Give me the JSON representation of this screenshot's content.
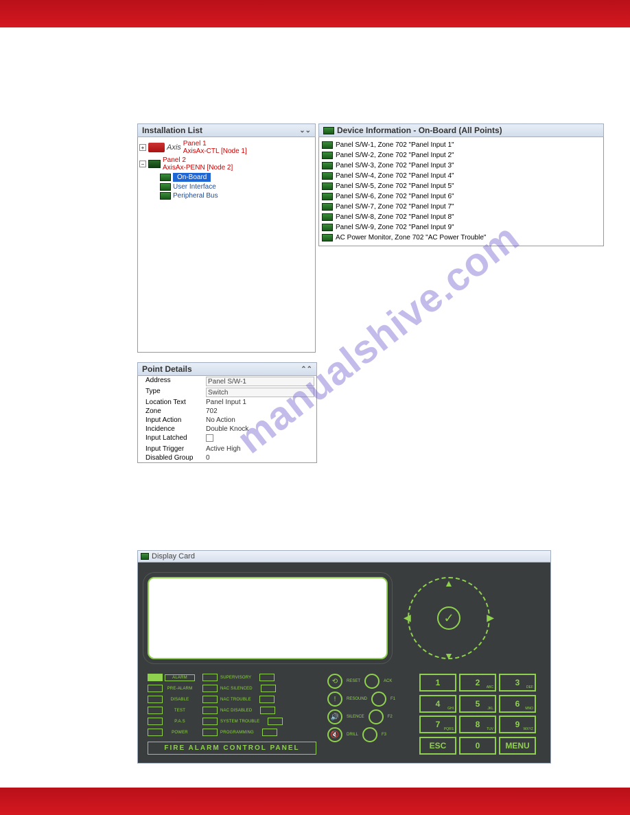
{
  "watermark": "manualshive.com",
  "installList": {
    "title": "Installation List",
    "panel1": {
      "title": "Panel 1",
      "sub": "AxisAx-CTL [Node 1]",
      "logo": "Axis"
    },
    "panel2": {
      "title": "Panel 2",
      "sub": "AxisAx-PENN [Node 2]"
    },
    "onboard": "On-Board",
    "userInterface": "User Interface",
    "peripheralBus": "Peripheral Bus"
  },
  "deviceInfo": {
    "title": "Device Information - On-Board  (All Points)",
    "rows": [
      "Panel S/W-1, Zone 702 \"Panel Input 1\"",
      "Panel S/W-2, Zone 702 \"Panel Input 2\"",
      "Panel S/W-3, Zone 702 \"Panel Input 3\"",
      "Panel S/W-4, Zone 702 \"Panel Input 4\"",
      "Panel S/W-5, Zone 702 \"Panel Input 5\"",
      "Panel S/W-6, Zone 702 \"Panel Input 6\"",
      "Panel S/W-7, Zone 702 \"Panel Input 7\"",
      "Panel S/W-8, Zone 702 \"Panel Input 8\"",
      "Panel S/W-9, Zone 702 \"Panel Input 9\"",
      "AC Power Monitor, Zone 702 \"AC Power Trouble\""
    ]
  },
  "pointDetails": {
    "title": "Point Details",
    "rows": [
      {
        "label": "Address",
        "value": "Panel S/W-1",
        "input": true
      },
      {
        "label": "Type",
        "value": "Switch",
        "input": true
      },
      {
        "label": "Location Text",
        "value": "Panel Input 1"
      },
      {
        "label": "Zone",
        "value": "702"
      },
      {
        "label": "Input Action",
        "value": "No Action"
      },
      {
        "label": "Incidence",
        "value": "Double Knock"
      },
      {
        "label": "Input Latched",
        "value": "",
        "check": true
      },
      {
        "label": "Input Trigger",
        "value": "Active High"
      },
      {
        "label": "Disabled Group",
        "value": "0"
      }
    ]
  },
  "displayCard": {
    "title": "Display Card",
    "brand": "FIRE ALARM CONTROL PANEL",
    "leds": {
      "col1": [
        "ALARM",
        "PRE-ALARM",
        "DISABLE",
        "TEST",
        "P.A.S",
        "POWER"
      ],
      "col2": [
        "SUPERVISORY",
        "NAC SILENCED",
        "NAC TROUBLE",
        "NAC DISABLED",
        "SYSTEM TROUBLE",
        "PROGRAMMING"
      ]
    },
    "controls": [
      [
        "RESET",
        "ACK"
      ],
      [
        "RESOUND",
        "F1"
      ],
      [
        "SILENCE",
        "F2"
      ],
      [
        "DRILL",
        "F3"
      ]
    ],
    "keypad": [
      {
        "n": "1",
        "s": ""
      },
      {
        "n": "2",
        "s": "ABC"
      },
      {
        "n": "3",
        "s": "DEF"
      },
      {
        "n": "4",
        "s": "GHI"
      },
      {
        "n": "5",
        "s": "JKL"
      },
      {
        "n": "6",
        "s": "MNO"
      },
      {
        "n": "7",
        "s": "PQRS"
      },
      {
        "n": "8",
        "s": "TUV"
      },
      {
        "n": "9",
        "s": "WXYZ"
      },
      {
        "n": "ESC",
        "s": ""
      },
      {
        "n": "0",
        "s": ""
      },
      {
        "n": "MENU",
        "s": ""
      }
    ]
  }
}
